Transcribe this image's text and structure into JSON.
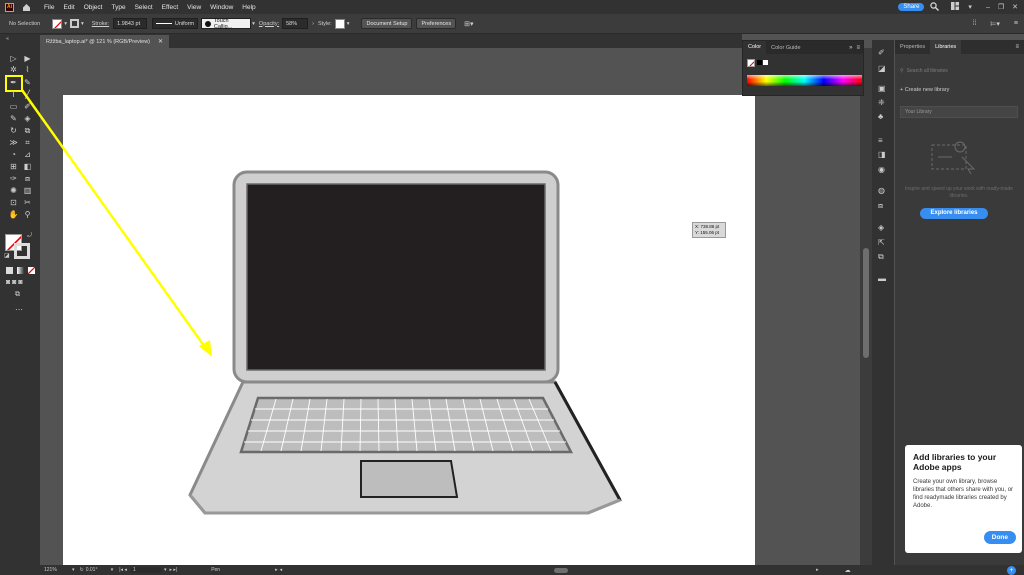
{
  "menu": {
    "items": [
      "File",
      "Edit",
      "Object",
      "Type",
      "Select",
      "Effect",
      "View",
      "Window",
      "Help"
    ],
    "share_label": "Share"
  },
  "control": {
    "selection_label": "No Selection",
    "stroke_label": "Stroke:",
    "stroke_value": "1.9843 pt",
    "profile_value": "Uniform",
    "brush_value": "Touch Callig...",
    "opacity_label": "Opacity:",
    "opacity_value": "58%",
    "style_label": "Style:",
    "document_setup_label": "Document Setup",
    "preferences_label": "Preferences"
  },
  "document": {
    "tab_title": "Ržžba_laptop.ai* @ 121 % (RGB/Preview)",
    "coord_x": "X: 738.86 pt",
    "coord_y": "Y: 155.06 pt"
  },
  "color_panel": {
    "tab_color": "Color",
    "tab_color_guide": "Color Guide"
  },
  "libraries_panel": {
    "tab_properties": "Properties",
    "tab_libraries": "Libraries",
    "search_placeholder": "Search all libraries",
    "create_label": "Create new library",
    "your_library": "Your Library",
    "inspire_text": "Inspire and speed up your work with ready-made libraries.",
    "explore_label": "Explore libraries"
  },
  "popup": {
    "title": "Add libraries to your Adobe apps",
    "body": "Create your own library, browse libraries that others share with you, or find readymade libraries created by Adobe.",
    "done_label": "Done"
  },
  "status": {
    "zoom": "121%",
    "rotation": "0.01°",
    "artboard_num": "1",
    "tool_name": "Pen"
  },
  "colors": {
    "accent": "#378ef0",
    "highlight": "#ffff00",
    "ui_dark": "#323232"
  }
}
